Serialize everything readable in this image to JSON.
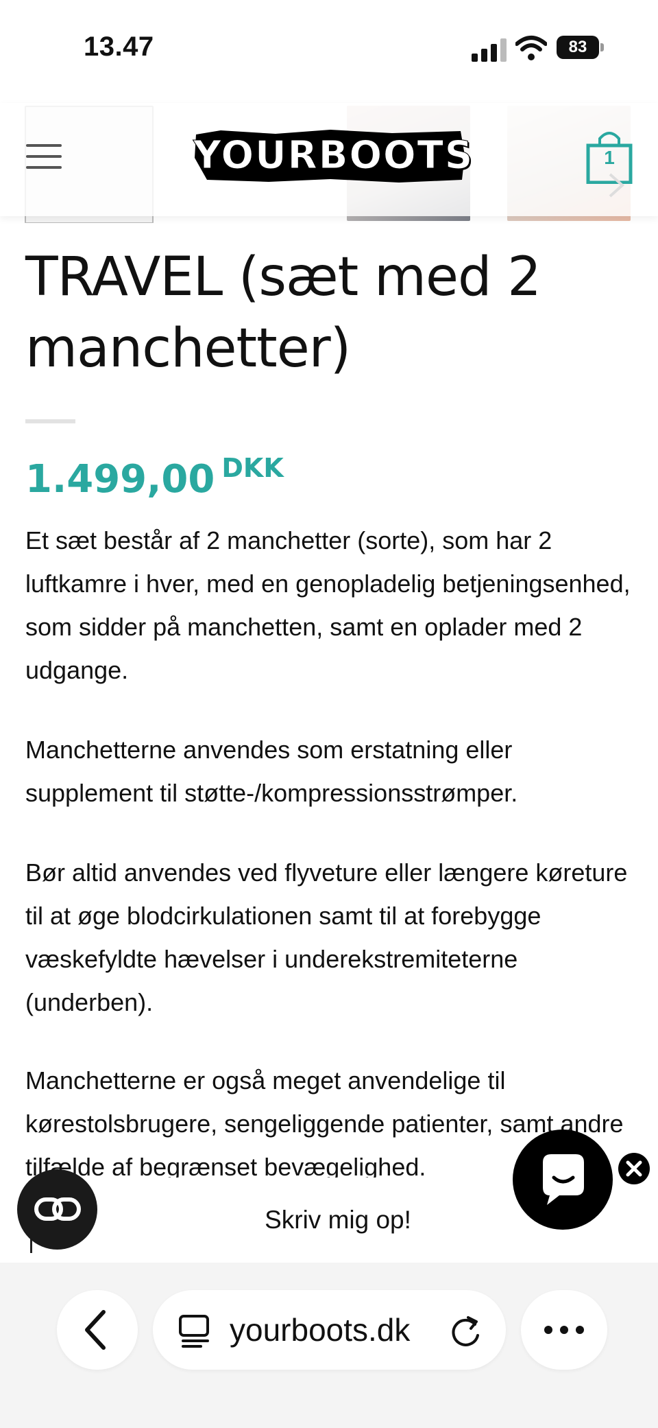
{
  "status_bar": {
    "time": "13.47",
    "battery": "83"
  },
  "header": {
    "logo": "YOURBOOTS",
    "cart_count": "1"
  },
  "product": {
    "title": "TRAVEL (sæt med 2 manchetter)",
    "price_amount": "1.499,00",
    "price_currency": "DKK",
    "description": [
      "Et sæt består af 2 manchetter (sorte), som har 2 luftkamre i hver, med en genopladelig betjeningsenhed, som sidder på manchetten, samt en oplader med 2 udgange.",
      "Manchetterne anvendes som erstatning eller supplement til støtte-/kompressionsstrømper.",
      "Bør altid anvendes ved flyveture eller længere køreture til at øge blodcirkulationen samt til at forebygge væskefyldte hævelser i underekstremiteterne (underben).",
      "Manchetterne er også meget anvendelige til kørestolsbrugere, sengeliggende patienter, samt andre tilfælde af begrænset bevægelighed."
    ]
  },
  "signup": {
    "label": "Skriv mig op!"
  },
  "browser": {
    "url": "yourboots.dk"
  },
  "colors": {
    "accent": "#2aa8a0"
  },
  "icons": [
    "menu-icon",
    "cart-icon",
    "chat-icon",
    "close-icon",
    "accessibility-icon",
    "back-icon",
    "reader-icon",
    "reload-icon",
    "more-icon"
  ]
}
